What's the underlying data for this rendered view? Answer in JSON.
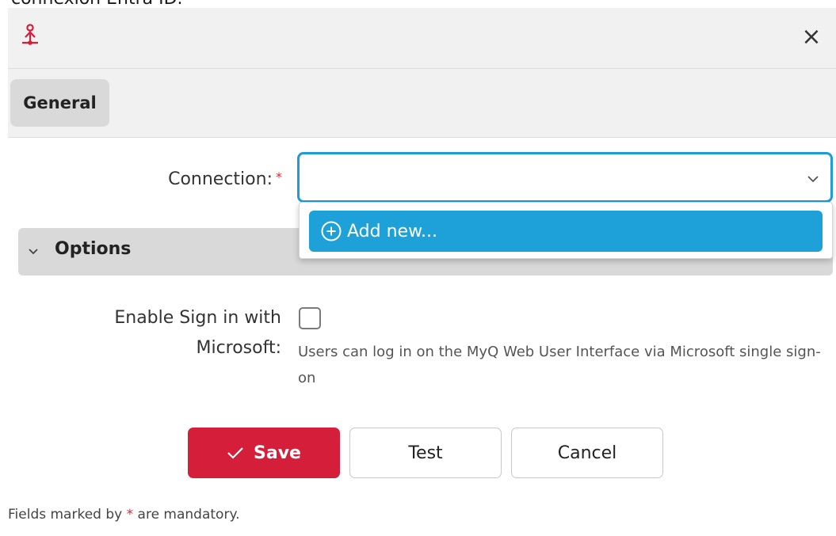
{
  "top_cut_text": "connexion Entra ID.",
  "dialog": {
    "close_glyph": "×",
    "app_icon": "sso-connector-icon",
    "tabs": [
      {
        "label": "General"
      }
    ]
  },
  "form": {
    "connection": {
      "label": "Connection:",
      "required_mark": "*",
      "value": "",
      "dropdown_items": [
        {
          "label": "Add new...",
          "icon": "plus-circle-icon"
        }
      ]
    },
    "options_section": {
      "title": "Options",
      "expanded": true
    },
    "sign_in_microsoft": {
      "label_line1": "Enable Sign in with",
      "label_line2": "Microsoft:",
      "checked": false,
      "help": "Users can log in on the MyQ Web User Interface via Microsoft single sign-on"
    }
  },
  "buttons": {
    "save": "Save",
    "test": "Test",
    "cancel": "Cancel"
  },
  "footnote": {
    "prefix": "Fields marked by",
    "star": "*",
    "suffix": "are mandatory."
  },
  "colors": {
    "accent_blue": "#1ea0d8",
    "brand_red": "#d51e3a"
  }
}
